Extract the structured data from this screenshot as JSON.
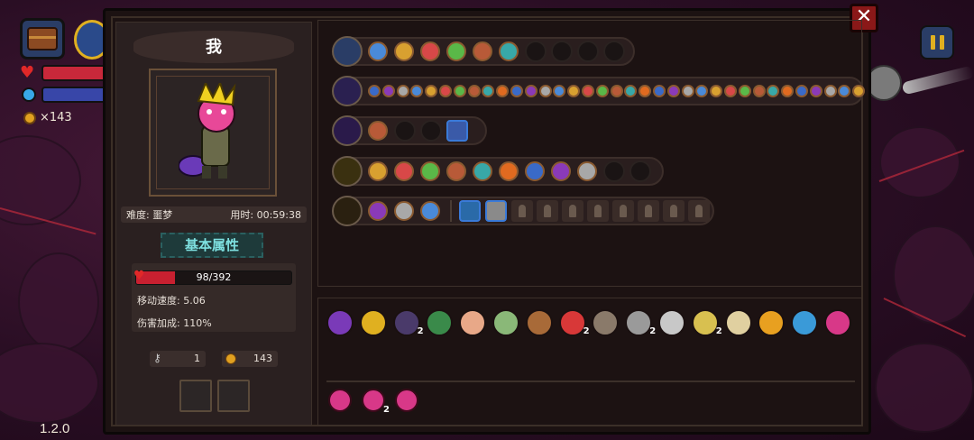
{
  "hud": {
    "coin_count": "×143",
    "version": "1.2.0"
  },
  "character": {
    "name": "我",
    "difficulty": "难度: 噩梦",
    "time": "用时: 00:59:38",
    "section_title": "基本属性",
    "hp_text": "98/392",
    "hp_fraction": 0.25,
    "move_speed": "移动速度: 5.06",
    "damage_bonus": "伤害加成: 110%",
    "keys": "1",
    "coins": "143"
  },
  "weapon_rows": [
    {
      "weapon": "chest-icon",
      "filled": 6,
      "empty": 4
    },
    {
      "weapon": "magic-staff-icon",
      "filled": 35,
      "empty": 0
    },
    {
      "weapon": "dark-orb-icon",
      "filled": 1,
      "empty": 2,
      "extra": 1
    },
    {
      "weapon": "golden-staff-icon",
      "filled": 9,
      "empty": 2
    },
    {
      "weapon": "wooden-staff-icon",
      "filled": 3,
      "empty": 0,
      "special": 2,
      "locked": 8
    }
  ],
  "items": {
    "relics": [
      {
        "name": "purple-hood-icon",
        "count": ""
      },
      {
        "name": "gold-crystal-icon",
        "count": ""
      },
      {
        "name": "shadow-cloak-icon",
        "count": "2"
      },
      {
        "name": "green-boot-icon",
        "count": ""
      },
      {
        "name": "pink-egg-icon",
        "count": ""
      },
      {
        "name": "green-gem-icon",
        "count": ""
      },
      {
        "name": "brown-scroll-icon",
        "count": ""
      },
      {
        "name": "red-mask-icon",
        "count": "2"
      },
      {
        "name": "stone-idol-icon",
        "count": ""
      },
      {
        "name": "iron-sword-icon",
        "count": "2"
      },
      {
        "name": "bone-armor-icon",
        "count": ""
      },
      {
        "name": "gold-claw-icon",
        "count": "2"
      },
      {
        "name": "bone-bridge-icon",
        "count": ""
      },
      {
        "name": "golden-chalice-icon",
        "count": ""
      },
      {
        "name": "blue-ring-icon",
        "count": ""
      },
      {
        "name": "pink-crown-icon",
        "count": ""
      }
    ],
    "consumables": [
      {
        "name": "pink-potion-icon",
        "count": ""
      },
      {
        "name": "pink-potion-icon",
        "count": "2"
      },
      {
        "name": "pink-potion-icon",
        "count": ""
      }
    ]
  },
  "colors": {
    "hp": "#c82030",
    "title_accent": "#7ee0e0",
    "rune_border": "#8a5a30"
  }
}
